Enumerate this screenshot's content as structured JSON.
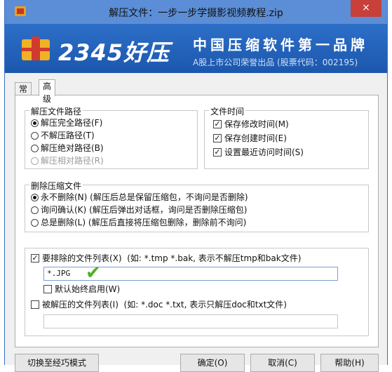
{
  "window": {
    "title": "解压文件：一步一步学摄影视频教程.zip",
    "close_label": "×"
  },
  "banner": {
    "brand": "2345好压",
    "slogan": "中国压缩软件第一品牌",
    "subslogan": "A股上市公司荣誉出品 (股票代码：002195)"
  },
  "tabs": [
    "常规",
    "高级"
  ],
  "extract_path": {
    "title": "解压文件路径",
    "options": [
      "解压完全路径(F)",
      "不解压路径(T)",
      "解压绝对路径(B)",
      "解压相对路径(R)"
    ],
    "selected": 0
  },
  "file_time": {
    "title": "文件时间",
    "options": [
      "保存修改时间(M)",
      "保存创建时间(E)",
      "设置最近访问时间(S)"
    ]
  },
  "delete_archive": {
    "title": "删除压缩文件",
    "options": [
      {
        "label": "永不删除(N)",
        "desc": "(解压后总是保留压缩包，不询问是否删除)"
      },
      {
        "label": "询问确认(K)",
        "desc": "(解压后弹出对话框，询问是否删除压缩包)"
      },
      {
        "label": "总是删除(L)",
        "desc": "(解压后直接将压缩包删除，删除前不询问)"
      }
    ],
    "selected": 0
  },
  "exclude": {
    "label": "要排除的文件列表(X)",
    "hint": "(如: *.tmp *.bak, 表示不解压tmp和bak文件)",
    "value": "*.JPG",
    "default_label": "默认始终启用(W)"
  },
  "include": {
    "label": "被解压的文件列表(I)",
    "hint": "(如: *.doc *.txt, 表示只解压doc和txt文件)",
    "value": ""
  },
  "buttons": {
    "simple_mode": "切换至经巧模式",
    "ok": "确定(O)",
    "cancel": "取消(C)",
    "help": "帮助(H)"
  },
  "colors": {
    "titlebar": "#5b8ed6",
    "banner": "#2d6fc8",
    "close": "#c7403a",
    "green_check": "#4fb21e"
  }
}
